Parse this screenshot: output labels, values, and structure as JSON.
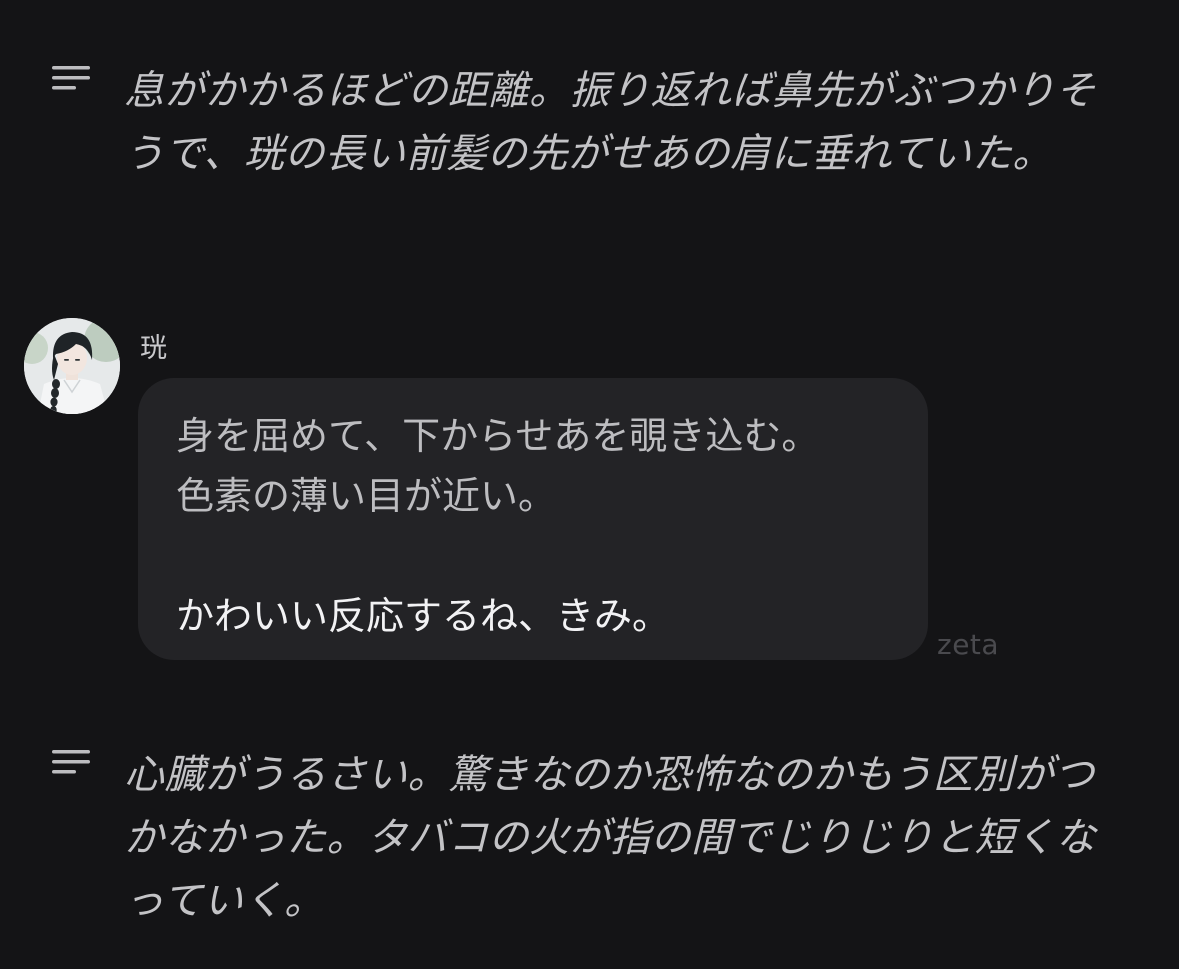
{
  "narration_top": {
    "icon": "narration-lines-icon",
    "text": "息がかかるほどの距離。振り返れば鼻先がぶつかりそうで、珖の長い前髪の先がせあの肩に垂れていた。"
  },
  "message": {
    "sender_name": "珖",
    "avatar": "character-avatar",
    "lines": [
      "身を屈めて、下からせあを覗き込む。",
      "色素の薄い目が近い。",
      "かわいい反応するね、きみ。"
    ]
  },
  "watermark": "zeta",
  "narration_bottom": {
    "icon": "narration-lines-icon",
    "text": "心臓がうるさい。驚きなのか恐怖なのかもう区別がつかなかった。タバコの火が指の間でじりじりと短くなっていく。"
  },
  "colors": {
    "background": "#141416",
    "bubble": "#232326",
    "text": "#c3c3c6",
    "bright_text": "#f2f2f4",
    "watermark": "#4a4a4e"
  }
}
